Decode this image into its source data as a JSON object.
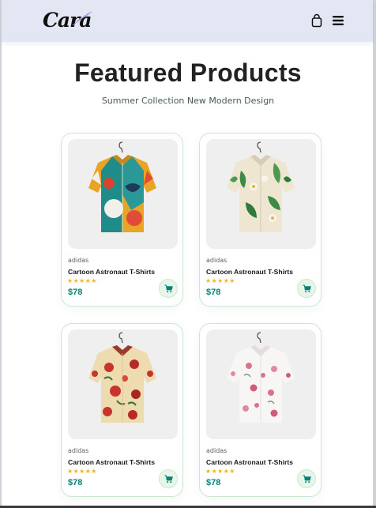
{
  "header": {
    "logo_text": "Cara",
    "bag_icon": "shopping-bag-icon",
    "menu_icon": "hamburger-menu-icon",
    "background": "#e3e6f3"
  },
  "section": {
    "title": "Featured Products",
    "subtitle": "Summer Collection New Modern Design"
  },
  "colors": {
    "accent": "#088178",
    "star": "#f3b519",
    "cart_bg": "#e8f6ea",
    "card_border": "#cce7d0"
  },
  "products": [
    {
      "brand": "adidas",
      "name": "Cartoon Astronaut T-Shirts",
      "stars": "★★★★★",
      "rating": 5,
      "price": "$78",
      "image": "teal-yellow-abstract-shirt"
    },
    {
      "brand": "adidas",
      "name": "Cartoon Astronaut T-Shirts",
      "stars": "★★★★★",
      "rating": 5,
      "price": "$78",
      "image": "cream-palm-leaf-shirt"
    },
    {
      "brand": "adidas",
      "name": "Cartoon Astronaut T-Shirts",
      "stars": "★★★★★",
      "rating": 5,
      "price": "$78",
      "image": "cream-red-floral-shirt"
    },
    {
      "brand": "adidas",
      "name": "Cartoon Astronaut T-Shirts",
      "stars": "★★★★★",
      "rating": 5,
      "price": "$78",
      "image": "white-pink-floral-shirt"
    }
  ]
}
